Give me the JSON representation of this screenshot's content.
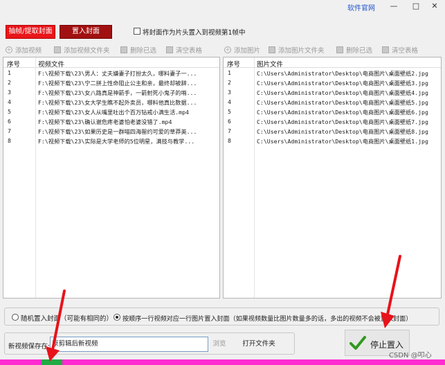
{
  "window": {
    "official_site_link": "软件官网",
    "minimize": "—",
    "restore": "□",
    "close": "✕"
  },
  "top": {
    "extract_cover_button": "抽帧/提取封面",
    "insert_cover_button": "置入封面",
    "cover_as_head_checkbox_label": "将封面作为片头置入到视频第1帧中"
  },
  "left_toolbar": {
    "add_video": "添加视频",
    "add_video_folder": "添加视频文件夹",
    "delete_selected": "删除已选",
    "clear_table": "清空表格"
  },
  "right_toolbar": {
    "add_image": "添加图片",
    "add_image_folder": "添加图片文件夹",
    "delete_selected": "删除已选",
    "clear_table": "清空表格"
  },
  "video_table": {
    "columns": [
      "序号",
      "视频文件"
    ],
    "rows": [
      {
        "no": "1",
        "file": "F:\\视频下载\\23\\男人：丈夫嫌妻子打扮太久，哪料妻子一..."
      },
      {
        "no": "2",
        "file": "F:\\视频下载\\23\\宁二拼上性命阻止公主和亲，最终却被辞..."
      },
      {
        "no": "3",
        "file": "F:\\视频下载\\23\\女八路真是神箭手，一箭射死小鬼子的哨..."
      },
      {
        "no": "4",
        "file": "F:\\视频下载\\23\\女大学生瞧不起外卖员，哪料他真比数据..."
      },
      {
        "no": "5",
        "file": "F:\\视频下载\\23\\女人从嘴里吐出个百万钻戒小满生活.mp4"
      },
      {
        "no": "6",
        "file": "F:\\视频下载\\23\\确认谢危疼老婆怕老婆没错了.mp4"
      },
      {
        "no": "7",
        "file": "F:\\视频下载\\23\\如果历史是一群喵四海罂约可爱的草莽英..."
      },
      {
        "no": "8",
        "file": "F:\\视频下载\\23\\实际是大学老师的5位明星，满技与教学..."
      }
    ]
  },
  "image_table": {
    "columns": [
      "序号",
      "图片文件"
    ],
    "rows": [
      {
        "no": "1",
        "file": "C:\\Users\\Administrator\\Desktop\\电商图片\\桌面壁纸2.jpg"
      },
      {
        "no": "2",
        "file": "C:\\Users\\Administrator\\Desktop\\电商图片\\桌面壁纸3.jpg"
      },
      {
        "no": "3",
        "file": "C:\\Users\\Administrator\\Desktop\\电商图片\\桌面壁纸4.jpg"
      },
      {
        "no": "4",
        "file": "C:\\Users\\Administrator\\Desktop\\电商图片\\桌面壁纸5.jpg"
      },
      {
        "no": "5",
        "file": "C:\\Users\\Administrator\\Desktop\\电商图片\\桌面壁纸6.jpg"
      },
      {
        "no": "6",
        "file": "C:\\Users\\Administrator\\Desktop\\电商图片\\桌面壁纸7.jpg"
      },
      {
        "no": "7",
        "file": "C:\\Users\\Administrator\\Desktop\\电商图片\\桌面壁纸8.jpg"
      },
      {
        "no": "8",
        "file": "C:\\Users\\Administrator\\Desktop\\电商图片\\桌面壁纸1.jpg"
      }
    ]
  },
  "options": {
    "random_insert": "随机置入封面（可能有相同的）",
    "sequential_insert": "按顺序一行视频对应一行图片置入封面（如果视频数量比图片数量多的话，多出的视频不会被置入封面）",
    "selected": "sequential"
  },
  "output": {
    "save_label": "新视频保存在:",
    "save_path": "原剪辑后新视频",
    "browse_button": "浏览",
    "open_folder_button": "打开文件夹",
    "stop_button": "停止置入"
  },
  "watermark": "CSDN @叩心",
  "colors": {
    "accent_red": "#e8161a",
    "arrow_red": "#e8121a",
    "progress_magenta": "#ff2bd0",
    "check_green": "#2f9a1e"
  }
}
